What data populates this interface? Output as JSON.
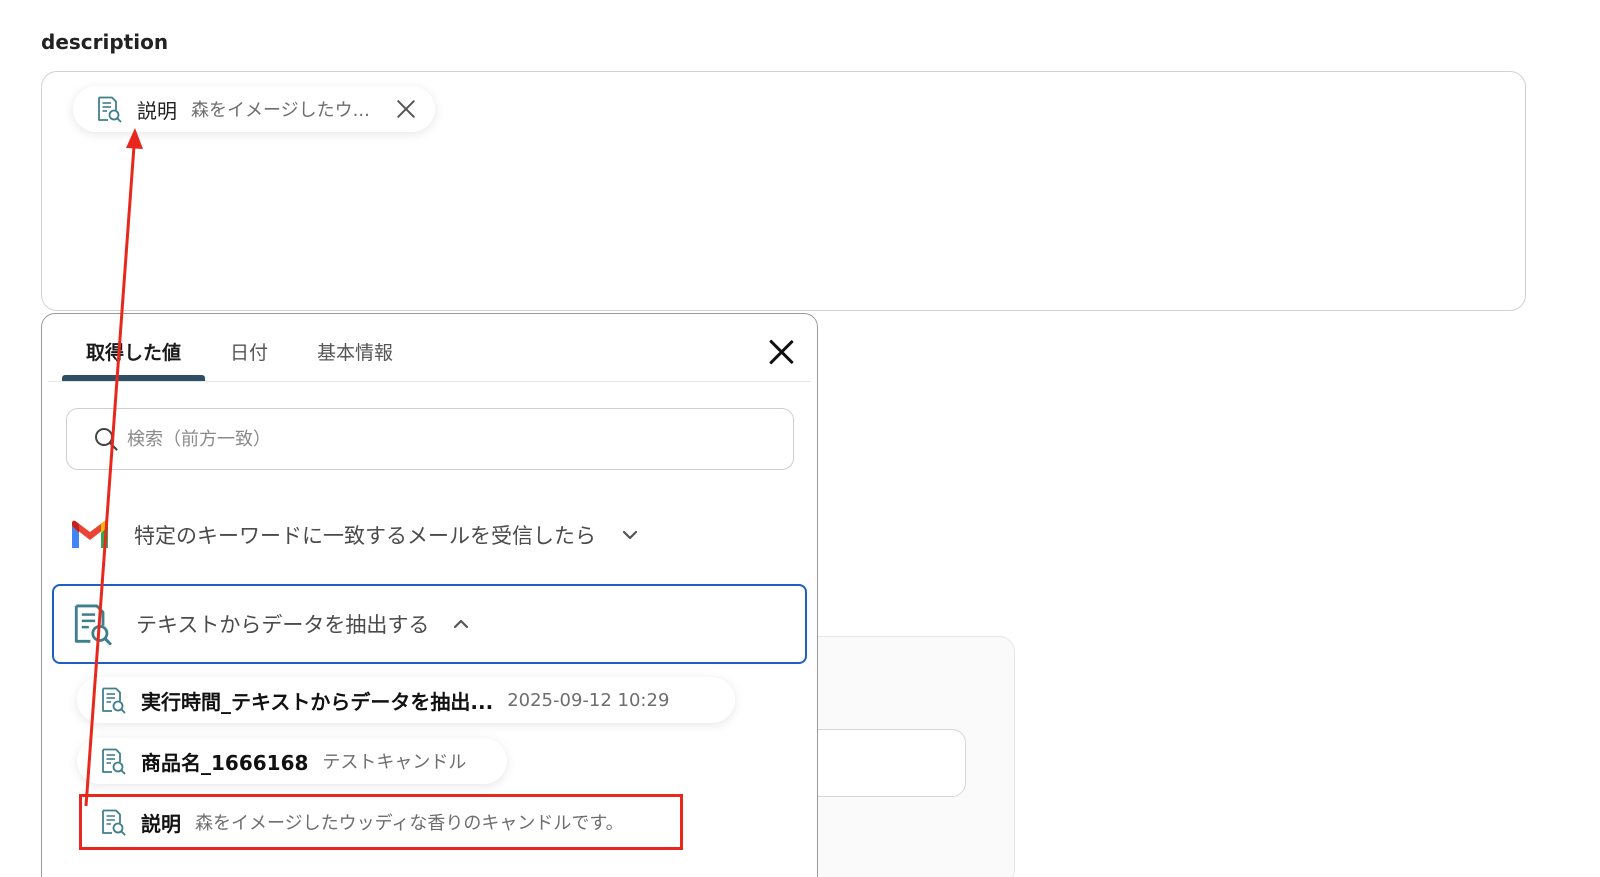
{
  "field": {
    "label": "description"
  },
  "token": {
    "name": "説明",
    "value": "森をイメージしたウ..."
  },
  "panel": {
    "tabs": [
      {
        "label": "取得した値",
        "active": true
      },
      {
        "label": "日付",
        "active": false
      },
      {
        "label": "基本情報",
        "active": false
      }
    ],
    "search": {
      "placeholder": "検索（前方一致）",
      "value": ""
    },
    "groups": [
      {
        "label": "特定のキーワードに一致するメールを受信したら",
        "icon": "gmail-icon",
        "expanded": false
      },
      {
        "label": "テキストからデータを抽出する",
        "icon": "document-search-icon",
        "expanded": true
      }
    ],
    "items": [
      {
        "name": "実行時間_テキストからデータを抽出...",
        "value": "2025-09-12 10:29"
      },
      {
        "name": "商品名_1666168",
        "value": "テストキャンドル"
      },
      {
        "name": "説明",
        "value": "森をイメージしたウッディな香りのキャンドルです。"
      }
    ]
  },
  "colors": {
    "accent_tab": "#2f4f66",
    "focus_border": "#1f5fc4",
    "annotation_red": "#e8281c",
    "icon_teal": "#3f7f8c"
  }
}
